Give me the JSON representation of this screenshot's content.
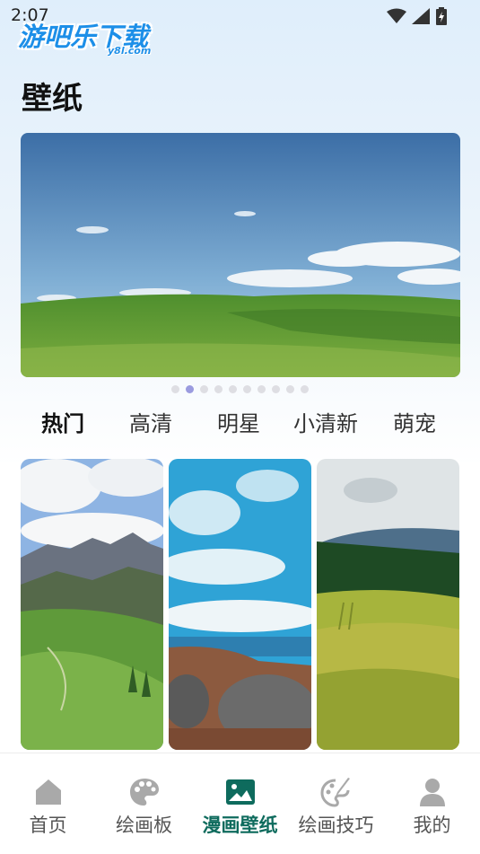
{
  "status_bar": {
    "time": "2:07"
  },
  "watermark": {
    "main": "游吧乐下载",
    "sub": "y8l.com"
  },
  "page": {
    "title": "壁纸"
  },
  "banner": {
    "dot_count": 10,
    "active_index": 1
  },
  "categories": [
    {
      "label": "热门",
      "active": true
    },
    {
      "label": "高清",
      "active": false
    },
    {
      "label": "明星",
      "active": false
    },
    {
      "label": "小清新",
      "active": false
    },
    {
      "label": "萌宠",
      "active": false
    }
  ],
  "wallpapers": [
    {
      "name": "mountain-valley"
    },
    {
      "name": "sky-coast"
    },
    {
      "name": "grass-field"
    }
  ],
  "bottom_nav": [
    {
      "label": "首页",
      "icon": "home-icon",
      "active": false
    },
    {
      "label": "绘画板",
      "icon": "palette-icon",
      "active": false
    },
    {
      "label": "漫画壁纸",
      "icon": "image-icon",
      "active": true
    },
    {
      "label": "绘画技巧",
      "icon": "brush-palette-icon",
      "active": false
    },
    {
      "label": "我的",
      "icon": "person-icon",
      "active": false
    }
  ],
  "colors": {
    "accent": "#0e6b5d",
    "dot_active": "#9b9bdf",
    "watermark": "#1d8fe8"
  }
}
